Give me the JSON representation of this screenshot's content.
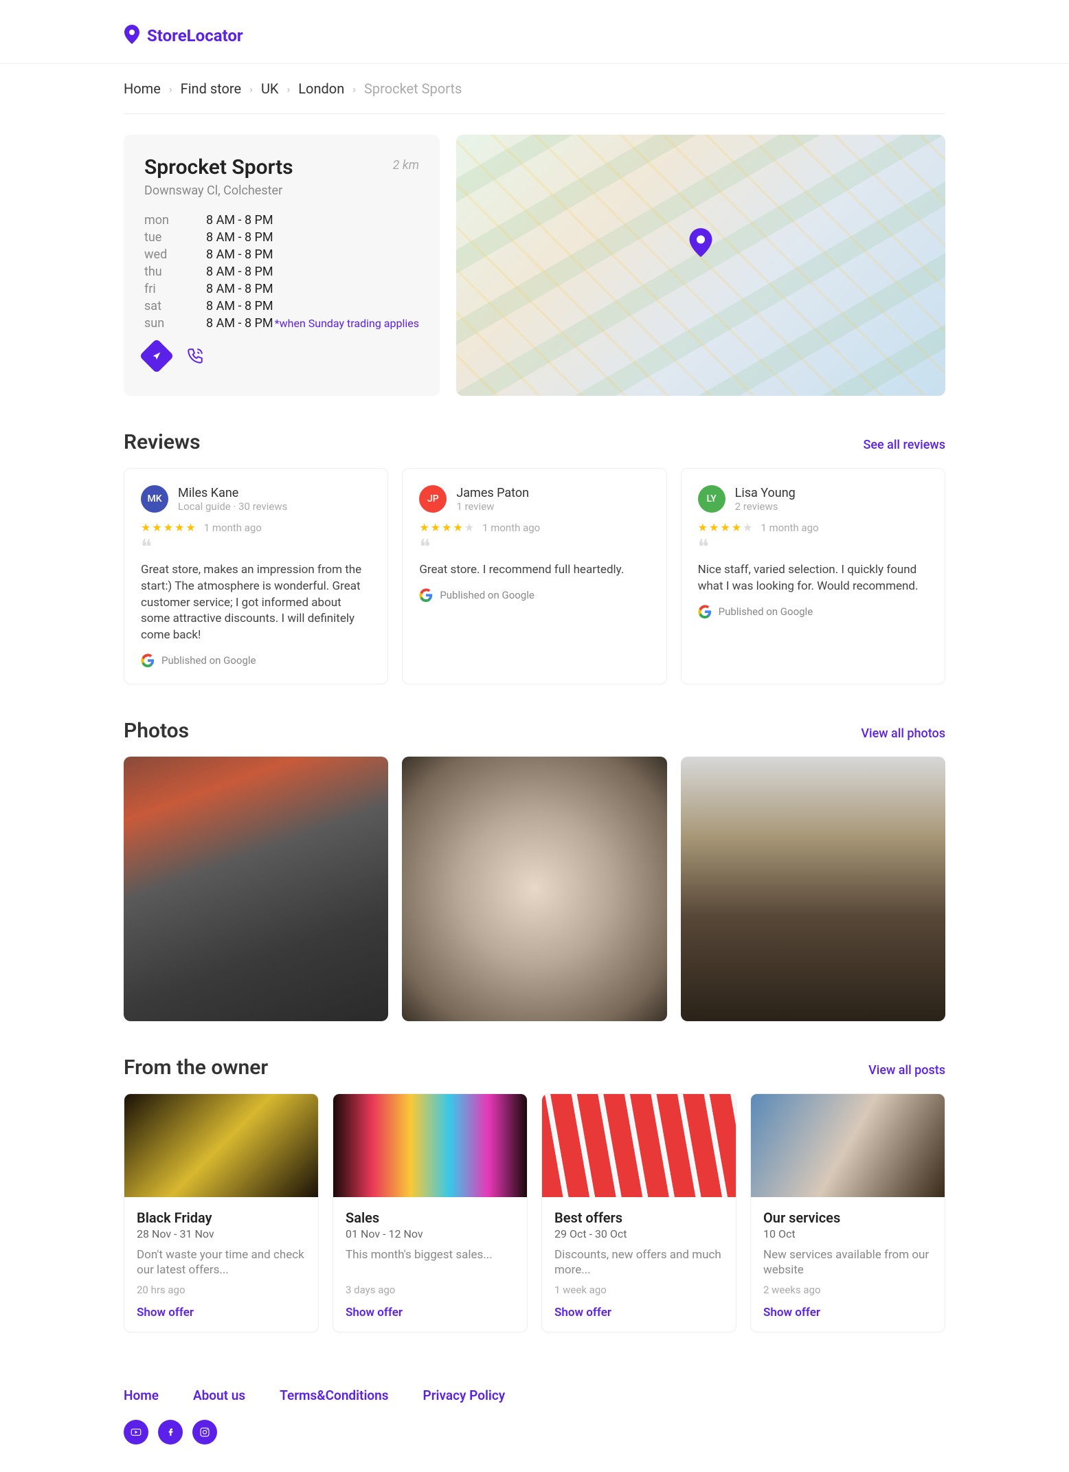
{
  "brand": {
    "name": "StoreLocator"
  },
  "breadcrumb": {
    "items": [
      "Home",
      "Find store",
      "UK",
      "London"
    ],
    "current": "Sprocket Sports"
  },
  "store": {
    "name": "Sprocket Sports",
    "distance": "2 km",
    "address": "Downsway Cl, Colchester",
    "hours": [
      {
        "day": "mon",
        "time": "8 AM - 8 PM"
      },
      {
        "day": "tue",
        "time": "8 AM - 8 PM"
      },
      {
        "day": "wed",
        "time": "8 AM - 8 PM"
      },
      {
        "day": "thu",
        "time": "8 AM - 8 PM"
      },
      {
        "day": "fri",
        "time": "8 AM - 8 PM"
      },
      {
        "day": "sat",
        "time": "8 AM - 8 PM"
      },
      {
        "day": "sun",
        "time": "8 AM - 8 PM"
      }
    ],
    "hours_note": "*when Sunday trading applies"
  },
  "reviews": {
    "title": "Reviews",
    "see_all": "See all reviews",
    "published_label": "Published on Google",
    "items": [
      {
        "initials": "MK",
        "avatar_color": "#3F51B5",
        "name": "Miles Kane",
        "subtitle": "Local guide · 30 reviews",
        "stars": 5,
        "time": "1 month ago",
        "text": "Great store, makes an impression from the start:) The atmosphere is wonderful. Great customer service; I got informed about some attractive discounts. I will definitely come back!"
      },
      {
        "initials": "JP",
        "avatar_color": "#F44336",
        "name": "James Paton",
        "subtitle": "1 review",
        "stars": 4,
        "time": "1 month ago",
        "text": "Great store. I recommend full heartedly."
      },
      {
        "initials": "LY",
        "avatar_color": "#4CAF50",
        "name": "Lisa Young",
        "subtitle": "2 reviews",
        "stars": 4,
        "time": "1 month ago",
        "text": "Nice staff, varied selection. I quickly found what I was looking for. Would recommend."
      }
    ]
  },
  "photos": {
    "title": "Photos",
    "see_all": "View all photos"
  },
  "posts": {
    "title": "From the owner",
    "see_all": "View all posts",
    "cta": "Show offer",
    "items": [
      {
        "title": "Black Friday",
        "date": "28 Nov - 31 Nov",
        "desc": "Don't waste your time and check our latest offers...",
        "ago": "20 hrs ago"
      },
      {
        "title": "Sales",
        "date": "01 Nov - 12 Nov",
        "desc": "This month's biggest sales...",
        "ago": "3 days ago"
      },
      {
        "title": "Best offers",
        "date": "29 Oct - 30 Oct",
        "desc": "Discounts, new offers and much more...",
        "ago": "1 week ago"
      },
      {
        "title": "Our services",
        "date": "10 Oct",
        "desc": "New services available from our website",
        "ago": "2 weeks ago"
      }
    ]
  },
  "footer": {
    "links": [
      "Home",
      "About us",
      "Terms&Conditions",
      "Privacy Policy"
    ]
  }
}
